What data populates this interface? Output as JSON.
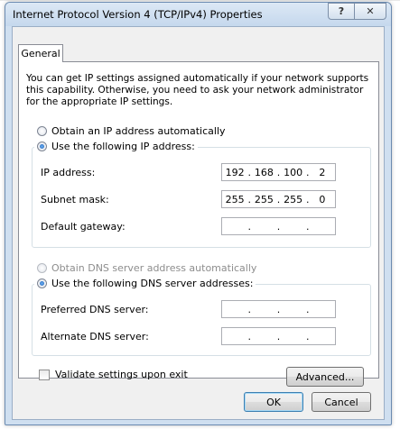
{
  "window": {
    "title": "Internet Protocol Version 4 (TCP/IPv4) Properties",
    "help_label": "?",
    "close_label": "✕"
  },
  "tab": {
    "label": "General"
  },
  "intro_text": "You can get IP settings assigned automatically if your network supports this capability. Otherwise, you need to ask your network administrator for the appropriate IP settings.",
  "ip_section": {
    "auto_label": "Obtain an IP address automatically",
    "manual_label": "Use the following IP address:",
    "selected": "manual",
    "fields": [
      {
        "label": "IP address:",
        "octets": [
          "192",
          "168",
          "100",
          "2"
        ]
      },
      {
        "label": "Subnet mask:",
        "octets": [
          "255",
          "255",
          "255",
          "0"
        ]
      },
      {
        "label": "Default gateway:",
        "octets": [
          "",
          "",
          "",
          ""
        ]
      }
    ]
  },
  "dns_section": {
    "auto_label": "Obtain DNS server address automatically",
    "manual_label": "Use the following DNS server addresses:",
    "selected": "manual",
    "fields": [
      {
        "label": "Preferred DNS server:",
        "octets": [
          "",
          "",
          "",
          ""
        ]
      },
      {
        "label": "Alternate DNS server:",
        "octets": [
          "",
          "",
          "",
          ""
        ]
      }
    ]
  },
  "validate": {
    "label": "Validate settings upon exit",
    "checked": false
  },
  "buttons": {
    "advanced": "Advanced...",
    "ok": "OK",
    "cancel": "Cancel"
  },
  "colors": {
    "title_bar": "#c5d8ed",
    "selected_radio": "#1a5fb4",
    "disabled_text": "#8d8d8d"
  }
}
